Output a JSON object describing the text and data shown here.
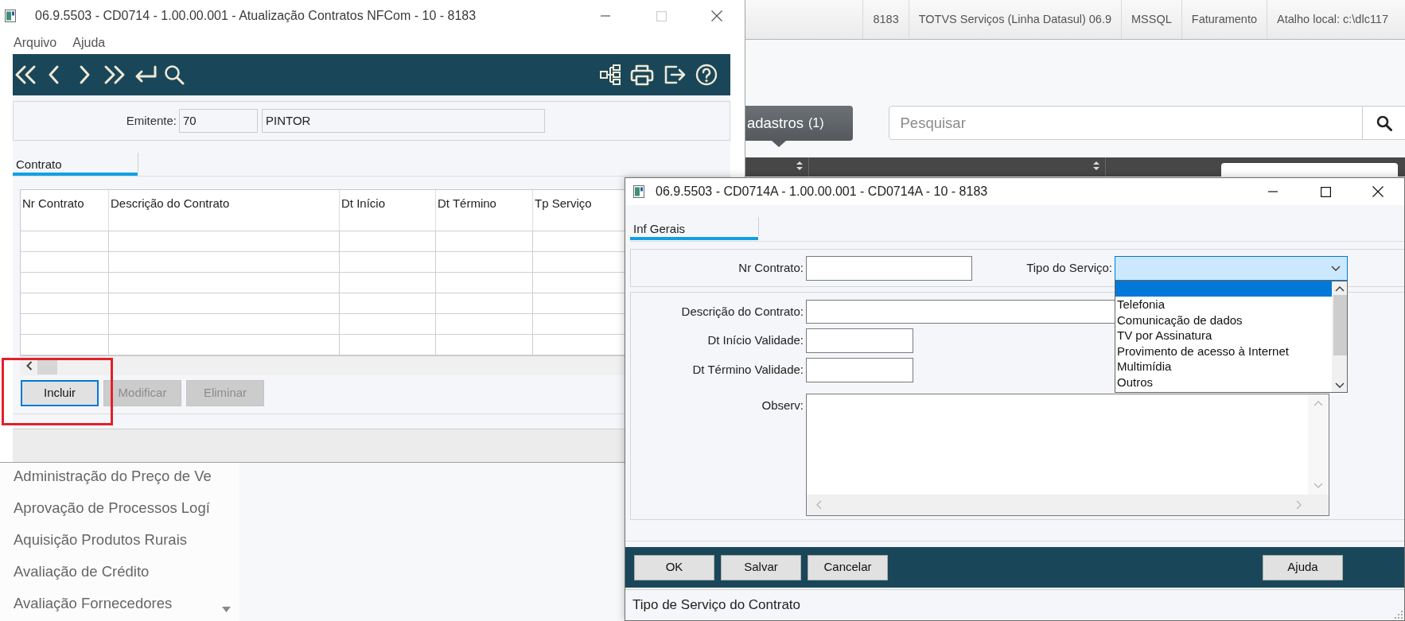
{
  "background_app": {
    "status_items": [
      "8183",
      "TOTVS Serviços (Linha Datasul) 06.9",
      "MSSQL",
      "Faturamento",
      "Atalho local: c:\\dlc117"
    ],
    "category_button": {
      "label": "adastros",
      "count": "(1)"
    },
    "search": {
      "placeholder": "Pesquisar"
    },
    "side_menu": [
      "Administração do Preço de Ve",
      "Aprovação de Processos Logí",
      "Aquisição Produtos Rurais",
      "Avaliação de Crédito",
      "Avaliação Fornecedores"
    ]
  },
  "main_window": {
    "title": "06.9.5503 - CD0714 - 1.00.00.001 - Atualização Contratos NFCom - 10 - 8183",
    "menu": [
      "Arquivo",
      "Ajuda"
    ],
    "emitente": {
      "label": "Emitente:",
      "code": "70",
      "name": "PINTOR"
    },
    "tabs": [
      {
        "label": "Contrato",
        "selected": true
      }
    ],
    "table": {
      "columns": [
        "Nr Contrato",
        "Descrição do Contrato",
        "Dt Início",
        "Dt Término",
        "Tp Serviço"
      ]
    },
    "buttons": [
      {
        "label": "Incluir",
        "disabled": false,
        "focused": true,
        "highlighted": true
      },
      {
        "label": "Modificar",
        "disabled": true,
        "focused": false,
        "highlighted": false
      },
      {
        "label": "Eliminar",
        "disabled": true,
        "focused": false,
        "highlighted": false
      }
    ]
  },
  "dialog": {
    "title": "06.9.5503 - CD0714A - 1.00.00.001 - CD0714A - 10 - 8183",
    "tabs": [
      {
        "label": "Inf Gerais",
        "selected": true
      }
    ],
    "nr_contrato": {
      "label": "Nr Contrato:"
    },
    "tipo_servico": {
      "label": "Tipo do Serviço:",
      "focused": true,
      "expanded": true,
      "options": [
        {
          "selected": true
        },
        {
          "label": "Telefonia",
          "selected": false
        },
        {
          "label": "Comunicação de dados",
          "selected": false
        },
        {
          "label": "TV por Assinatura",
          "selected": false
        },
        {
          "label": "Provimento de acesso à Internet",
          "selected": false
        },
        {
          "label": "Multimídia",
          "selected": false
        },
        {
          "label": "Outros",
          "selected": false
        }
      ]
    },
    "descricao": {
      "label": "Descrição do Contrato:"
    },
    "dt_inicio": {
      "label": "Dt Início Validade:"
    },
    "dt_termino": {
      "label": "Dt Término Validade:"
    },
    "observ": {
      "label": "Observ:"
    },
    "buttons": [
      "OK",
      "Salvar",
      "Cancelar"
    ],
    "help_button": "Ajuda",
    "status_bar": "Tipo de Serviço do Contrato"
  }
}
